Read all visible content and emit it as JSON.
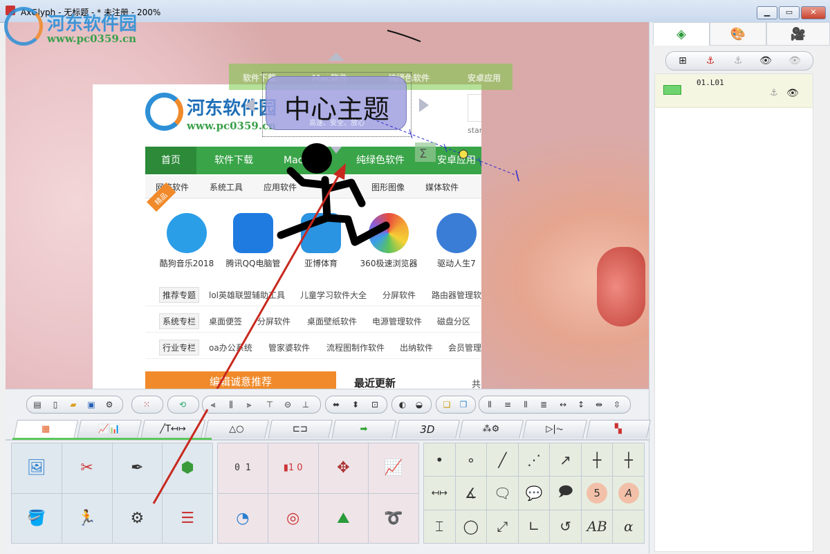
{
  "window": {
    "title": "AxGlyph - 无标题 - * 未注册 - 200%",
    "min_label": "▁",
    "max_label": "▭",
    "close_label": "✕"
  },
  "watermark": {
    "name": "河东软件园",
    "url": "www.pc0359.cn"
  },
  "canvas": {
    "topic_text": "中心主题",
    "topic_sub": "高速、安全、放心",
    "banner": [
      "软件下载",
      "Mac软件",
      "纯绿色软件",
      "安卓应用"
    ]
  },
  "website": {
    "name": "河东软件园",
    "url": "www.pc0359.cn",
    "start": "start",
    "nav": [
      "首页",
      "软件下载",
      "Mac",
      "纯绿色软件",
      "安卓应用"
    ],
    "subnav": [
      "网络软件",
      "系统工具",
      "应用软件",
      "图形图像",
      "媒体软件"
    ],
    "badge": "精品",
    "apps": [
      {
        "label": "酷狗音乐2018",
        "color": "#2b9ee8"
      },
      {
        "label": "腾讯QQ电脑管",
        "color": "#1f7be0"
      },
      {
        "label": "亚博体育",
        "color": "#2a93e2"
      },
      {
        "label": "360极速浏览器",
        "color": "#f4a535"
      },
      {
        "label": "驱动人生7",
        "color": "#3a7dd6"
      }
    ],
    "tag_rows": [
      {
        "head": "推荐专题",
        "items": [
          "lol英雄联盟辅助工具",
          "儿童学习软件大全",
          "分屏软件",
          "路由器管理软"
        ]
      },
      {
        "head": "系统专栏",
        "items": [
          "桌面便签",
          "分屏软件",
          "桌面壁纸软件",
          "电源管理软件",
          "磁盘分区"
        ]
      },
      {
        "head": "行业专栏",
        "items": [
          "oa办公系统",
          "管家婆软件",
          "流程图制作软件",
          "出纳软件",
          "会员管理"
        ]
      }
    ],
    "recommend": "编辑诚意推荐",
    "latest": "最近更新",
    "latest_extra": "共"
  },
  "right_panel": {
    "tabs": [
      "layers-icon",
      "palette-icon",
      "camera-icon"
    ],
    "layer_tools": [
      "add-layer-icon",
      "anchor-icon",
      "anchor-disabled-icon",
      "eye-icon",
      "eye-disabled-icon"
    ],
    "layer_name": "01.L01"
  },
  "toolbar_groups": [
    {
      "icons": [
        "menu-icon",
        "new-file-icon",
        "open-folder-icon",
        "save-icon",
        "settings-icon"
      ]
    },
    {
      "icons": [
        "grid-icon"
      ]
    },
    {
      "icons": [
        "rotate-icon"
      ]
    },
    {
      "icons": [
        "align-left-icon",
        "align-center-icon",
        "align-right-icon",
        "align-top-icon",
        "align-middle-icon",
        "align-bottom-icon"
      ]
    },
    {
      "icons": [
        "fit-width-icon",
        "fit-height-icon",
        "fit-size-icon"
      ]
    },
    {
      "icons": [
        "flip-h-icon",
        "flip-v-icon"
      ]
    },
    {
      "icons": [
        "bring-front-icon",
        "send-back-icon"
      ]
    },
    {
      "icons": [
        "distribute-h-icon",
        "distribute-v-icon",
        "space-h-icon",
        "space-v-icon",
        "same-width-icon",
        "same-height-icon",
        "same-w2-icon",
        "same-h2-icon"
      ]
    }
  ],
  "category_tabs": [
    {
      "name": "tab-general",
      "label": "▦"
    },
    {
      "name": "tab-charts",
      "label": "📈📊"
    },
    {
      "name": "tab-text",
      "label": "╱T↤↦"
    },
    {
      "name": "tab-shapes",
      "label": "△○"
    },
    {
      "name": "tab-diagram",
      "label": "⊏⊐"
    },
    {
      "name": "tab-arrows",
      "label": "➡"
    },
    {
      "name": "tab-3d",
      "label": "3D"
    },
    {
      "name": "tab-science",
      "label": "⁂⚙"
    },
    {
      "name": "tab-circuit",
      "label": "▷|⏦"
    },
    {
      "name": "tab-more",
      "label": "▚"
    }
  ],
  "grid_general": [
    {
      "name": "image-icon",
      "glyph": "🖼"
    },
    {
      "name": "scissors-icon",
      "glyph": "✂"
    },
    {
      "name": "pen-icon",
      "glyph": "✒"
    },
    {
      "name": "cube-pencil-icon",
      "glyph": "⬢"
    },
    {
      "name": "paint-bucket-icon",
      "glyph": "🪣"
    },
    {
      "name": "running-man-icon",
      "glyph": "🏃"
    },
    {
      "name": "head-gear-icon",
      "glyph": "⚙"
    },
    {
      "name": "mindmap-icon",
      "glyph": "☰"
    }
  ],
  "grid_charts": [
    {
      "name": "ruler-icon",
      "glyph": "0 1"
    },
    {
      "name": "colorbar-icon",
      "glyph": "▮1 0"
    },
    {
      "name": "axis-plot-icon",
      "glyph": "✥"
    },
    {
      "name": "line-chart-icon",
      "glyph": "📈"
    },
    {
      "name": "pie-chart-icon",
      "glyph": "◔"
    },
    {
      "name": "radar-chart-icon",
      "glyph": "◎"
    },
    {
      "name": "surface-icon",
      "glyph": "⛰"
    },
    {
      "name": "spiral-icon",
      "glyph": "➰"
    }
  ],
  "grid_shapes": [
    {
      "name": "dot-icon",
      "glyph": "•"
    },
    {
      "name": "circle-small-icon",
      "glyph": "∘"
    },
    {
      "name": "line-icon",
      "glyph": "╱"
    },
    {
      "name": "dashed-line-icon",
      "glyph": "⋰"
    },
    {
      "name": "arrow-line-icon",
      "glyph": "↗"
    },
    {
      "name": "crosshair-icon",
      "glyph": "┼"
    },
    {
      "name": "point-mark-icon",
      "glyph": "┼"
    },
    {
      "name": "dimension-icon",
      "glyph": "↤↦"
    },
    {
      "name": "angle-icon",
      "glyph": "∡"
    },
    {
      "name": "callout-rect-icon",
      "glyph": "🗨"
    },
    {
      "name": "callout-round-icon",
      "glyph": "💬"
    },
    {
      "name": "callout-oval-icon",
      "glyph": "🗩"
    },
    {
      "name": "number-badge-icon",
      "glyph": "5"
    },
    {
      "name": "letter-badge-icon",
      "glyph": "A"
    },
    {
      "name": "text-cursor-icon",
      "glyph": "⌶"
    },
    {
      "name": "circle-icon",
      "glyph": "◯"
    },
    {
      "name": "double-arrow-icon",
      "glyph": "⤢"
    },
    {
      "name": "right-angle-icon",
      "glyph": "∟"
    },
    {
      "name": "rotate-arrow-icon",
      "glyph": "↺"
    },
    {
      "name": "text-ab-icon",
      "glyph": "AB"
    },
    {
      "name": "alpha-icon",
      "glyph": "α"
    }
  ]
}
